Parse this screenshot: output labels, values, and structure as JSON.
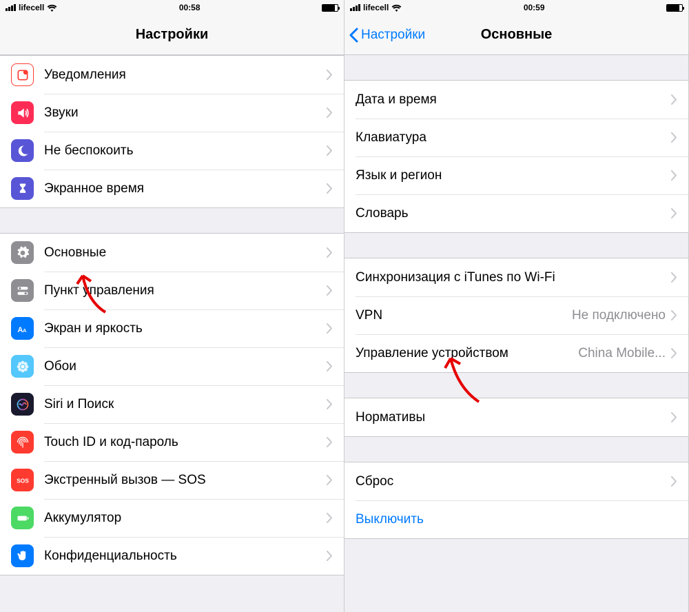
{
  "left": {
    "status": {
      "carrier": "lifecell",
      "time": "00:58"
    },
    "nav": {
      "title": "Настройки"
    },
    "group1": [
      {
        "key": "notifications",
        "label": "Уведомления",
        "color": "#ff3b30",
        "icon": "notifications"
      },
      {
        "key": "sounds",
        "label": "Звуки",
        "color": "#ff2d55",
        "icon": "sounds"
      },
      {
        "key": "dnd",
        "label": "Не беспокоить",
        "color": "#5856d6",
        "icon": "moon"
      },
      {
        "key": "screentime",
        "label": "Экранное время",
        "color": "#5856d6",
        "icon": "hourglass"
      }
    ],
    "group2": [
      {
        "key": "general",
        "label": "Основные",
        "color": "#8e8e93",
        "icon": "gear"
      },
      {
        "key": "controlcenter",
        "label": "Пункт управления",
        "color": "#8e8e93",
        "icon": "switches"
      },
      {
        "key": "display",
        "label": "Экран и яркость",
        "color": "#007aff",
        "icon": "aa"
      },
      {
        "key": "wallpaper",
        "label": "Обои",
        "color": "#54c7fc",
        "icon": "flower"
      },
      {
        "key": "siri",
        "label": "Siri и Поиск",
        "color": "#1a1a2e",
        "icon": "siri"
      },
      {
        "key": "touchid",
        "label": "Touch ID и код-пароль",
        "color": "#ff3b30",
        "icon": "fingerprint"
      },
      {
        "key": "sos",
        "label": "Экстренный вызов — SOS",
        "color": "#ff3b30",
        "icon": "sos"
      },
      {
        "key": "battery",
        "label": "Аккумулятор",
        "color": "#4cd964",
        "icon": "battery"
      },
      {
        "key": "privacy",
        "label": "Конфиденциальность",
        "color": "#007aff",
        "icon": "hand"
      }
    ]
  },
  "right": {
    "status": {
      "carrier": "lifecell",
      "time": "00:59"
    },
    "nav": {
      "back": "Настройки",
      "title": "Основные"
    },
    "group1": [
      {
        "key": "datetime",
        "label": "Дата и время"
      },
      {
        "key": "keyboard",
        "label": "Клавиатура"
      },
      {
        "key": "language",
        "label": "Язык и регион"
      },
      {
        "key": "dictionary",
        "label": "Словарь"
      }
    ],
    "group2": [
      {
        "key": "itunes-wifi",
        "label": "Синхронизация с iTunes по Wi-Fi"
      },
      {
        "key": "vpn",
        "label": "VPN",
        "value": "Не подключено"
      },
      {
        "key": "device-mgmt",
        "label": "Управление устройством",
        "value": "China Mobile..."
      }
    ],
    "group3": [
      {
        "key": "regulatory",
        "label": "Нормативы"
      }
    ],
    "group4": [
      {
        "key": "reset",
        "label": "Сброс"
      },
      {
        "key": "shutdown",
        "label": "Выключить",
        "link": true,
        "nochevron": true
      }
    ]
  }
}
